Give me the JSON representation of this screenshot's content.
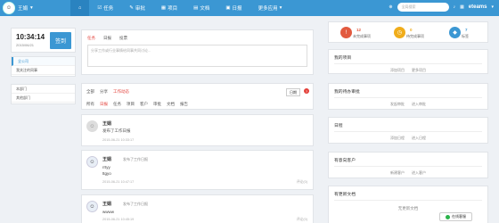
{
  "topbar": {
    "user_name": "王娟",
    "nav": [
      "任务",
      "审批",
      "项目",
      "文档",
      "日报",
      "更多应用"
    ],
    "search_placeholder": "全局搜索",
    "brand": "eteams"
  },
  "clock": {
    "time": "10:34:14",
    "date": "2015/06/21",
    "sign_in_label": "签到"
  },
  "left_menu": {
    "group1": [
      "全公司",
      "我关注的同事"
    ],
    "group2": [
      "本部门",
      "其他部门"
    ]
  },
  "composer": {
    "tabs": [
      "任务",
      "日报",
      "投票"
    ],
    "placeholder": "分享工作或行业事情给同事共同讨论..."
  },
  "feed": {
    "filter_tabs": [
      "全部",
      "分享",
      "工作动态"
    ],
    "sub_tabs": [
      "所有",
      "日报",
      "任务",
      "项目",
      "客户",
      "审批",
      "文档",
      "报告"
    ],
    "dropdown_label": "日期",
    "items": [
      {
        "name": "王娟",
        "action": "发布了工作日报",
        "time": "2015-06-21 10:33:17",
        "lines": []
      },
      {
        "name": "王娟",
        "action": "发布了工作日报",
        "time": "2015-06-21 10:47:17",
        "lines": [
          "rrtyy",
          "ttgyo"
        ],
        "comment": "评论(0)"
      },
      {
        "name": "王娟",
        "action": "发布了工作日报",
        "time": "2015-06-21 10:45:19",
        "lines": [
          "wwww"
        ],
        "comment": "评论(0)"
      }
    ]
  },
  "stats": [
    {
      "num": "12",
      "label": "未完成事项",
      "color": "#e25a3f",
      "icon": "alert-icon"
    },
    {
      "num": "0",
      "label": "待完成事项",
      "color": "#f0ad1b",
      "icon": "clock-icon"
    },
    {
      "num": "7",
      "label": "标签",
      "color": "#3b97d3",
      "icon": "tag-icon"
    }
  ],
  "widgets": [
    {
      "title": "我的项目",
      "links": [
        "添加项目",
        "更多项目"
      ]
    },
    {
      "title": "我的待办审批",
      "links": [
        "发起审批",
        "进入审批"
      ]
    },
    {
      "title": "日程",
      "links": [
        "添加日程",
        "进入日程"
      ]
    },
    {
      "title": "有意向客户",
      "links": [
        "新建客户",
        "进入客户"
      ]
    },
    {
      "title": "有更新文档",
      "links": [],
      "empty": "无更新文档"
    }
  ],
  "chat": {
    "label": "在线客服"
  }
}
